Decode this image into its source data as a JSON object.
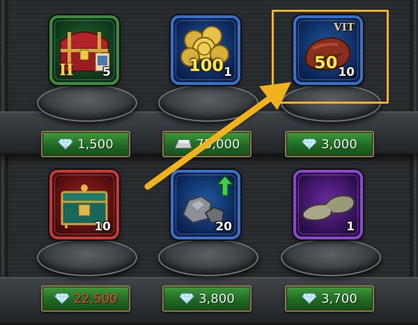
{
  "items": [
    {
      "id": "chest-ii",
      "frame": "green",
      "quantity": "5",
      "roman": "II",
      "price": "1,500",
      "currency": "gem-icon",
      "insufficient": false
    },
    {
      "id": "gold-coins",
      "frame": "blue",
      "quantity": "1",
      "big_label": "100",
      "price": "75,000",
      "currency": "silver-ingot-icon",
      "insufficient": false
    },
    {
      "id": "vit-meat",
      "frame": "blue",
      "quantity": "10",
      "big_label": "50",
      "tag": "VIT",
      "price": "3,000",
      "currency": "gem-icon",
      "insufficient": false
    },
    {
      "id": "green-chest",
      "frame": "red",
      "quantity": "10",
      "price": "22,500",
      "currency": "gem-icon",
      "insufficient": true
    },
    {
      "id": "ore-upgrade",
      "frame": "blue",
      "quantity": "20",
      "price": "3,800",
      "currency": "gem-icon",
      "insufficient": false
    },
    {
      "id": "slippers",
      "frame": "purple",
      "quantity": "1",
      "price": "3,700",
      "currency": "gem-icon",
      "insufficient": false
    }
  ],
  "colors": {
    "highlight": "#f2b21b",
    "arrow": "#f2b21b",
    "insufficient_price": "#ff3a2e"
  }
}
